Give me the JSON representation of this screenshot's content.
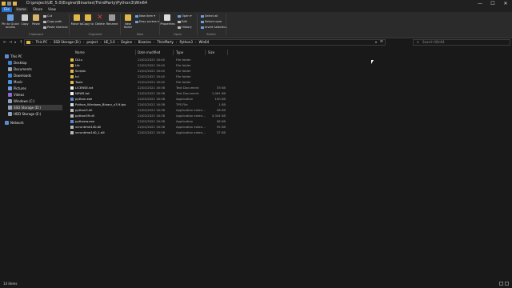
{
  "window": {
    "title": "D:\\project\\UE_5.0\\Engine\\Binaries\\ThirdParty\\Python3\\Win64"
  },
  "window_controls": {
    "minimize": "—",
    "maximize": "☐",
    "close": "✕"
  },
  "tabs": [
    "File",
    "Home",
    "Share",
    "View"
  ],
  "ribbon": {
    "pin": "Pin to Quick access",
    "copy": "Copy",
    "paste": "Paste",
    "cut": "Cut",
    "copy_path": "Copy path",
    "paste_shortcut": "Paste shortcut",
    "move_to": "Move to",
    "copy_to": "Copy to",
    "delete": "Delete",
    "rename": "Rename",
    "new_folder": "New folder",
    "new_item": "New item",
    "easy_access": "Easy access",
    "properties": "Properties",
    "open": "Open",
    "edit": "Edit",
    "history": "History",
    "select_all": "Select all",
    "select_none": "Select none",
    "invert_selection": "Invert selection",
    "groups": {
      "clipboard": "Clipboard",
      "organize": "Organize",
      "new": "New",
      "open": "Open",
      "select": "Select"
    }
  },
  "address": {
    "crumbs": [
      "This PC",
      "SSD Storage (D:)",
      "project",
      "UE_5.0",
      "Engine",
      "Binaries",
      "ThirdParty",
      "Python3",
      "Win64"
    ],
    "search_placeholder": "Search Win64"
  },
  "sidebar": {
    "items": [
      {
        "label": "This PC",
        "icon": "pc-icon"
      },
      {
        "label": "Desktop",
        "icon": "desktop-icon"
      },
      {
        "label": "Documents",
        "icon": "documents-icon"
      },
      {
        "label": "Downloads",
        "icon": "downloads-icon"
      },
      {
        "label": "Music",
        "icon": "music-icon"
      },
      {
        "label": "Pictures",
        "icon": "pictures-icon"
      },
      {
        "label": "Videos",
        "icon": "videos-icon"
      },
      {
        "label": "Windows (C:)",
        "icon": "drive-icon"
      },
      {
        "label": "SSD Storage (D:)",
        "icon": "drive-icon",
        "selected": true
      },
      {
        "label": "HDD Storage (E:)",
        "icon": "drive-icon"
      },
      {
        "label": "Network",
        "icon": "network-icon"
      }
    ]
  },
  "columns": [
    "Name",
    "Date modified",
    "Type",
    "Size"
  ],
  "files": [
    {
      "name": "DLLs",
      "date": "22/02/2022 16:40",
      "type": "File folder",
      "size": "",
      "icon": "folder"
    },
    {
      "name": "Lib",
      "date": "22/02/2022 16:40",
      "type": "File folder",
      "size": "",
      "icon": "folder"
    },
    {
      "name": "Scripts",
      "date": "22/02/2022 16:40",
      "type": "File folder",
      "size": "",
      "icon": "folder"
    },
    {
      "name": "tcl",
      "date": "22/02/2022 16:40",
      "type": "File folder",
      "size": "",
      "icon": "folder"
    },
    {
      "name": "Tools",
      "date": "22/02/2022 16:40",
      "type": "File folder",
      "size": "",
      "icon": "folder"
    },
    {
      "name": "LICENSE.txt",
      "date": "22/02/2022 16:38",
      "type": "Text Document",
      "size": "33 KB",
      "icon": "doc"
    },
    {
      "name": "NEWS.txt",
      "date": "22/02/2022 16:38",
      "type": "Text Document",
      "size": "1,061 KB",
      "icon": "doc"
    },
    {
      "name": "python.exe",
      "date": "22/02/2022 16:38",
      "type": "Application",
      "size": "100 KB",
      "icon": "app"
    },
    {
      "name": "Python_Windows_Binary_v3.9.tps",
      "date": "22/02/2022 16:38",
      "type": "TPS File",
      "size": "1 KB",
      "icon": "tps"
    },
    {
      "name": "python3.dll",
      "date": "22/02/2022 16:38",
      "type": "Application exten...",
      "size": "58 KB",
      "icon": "dll"
    },
    {
      "name": "python39.dll",
      "date": "22/02/2022 16:38",
      "type": "Application exten...",
      "size": "4,344 KB",
      "icon": "dll"
    },
    {
      "name": "pythonw.exe",
      "date": "22/02/2022 16:38",
      "type": "Application",
      "size": "98 KB",
      "icon": "app"
    },
    {
      "name": "vcruntime140.dll",
      "date": "22/02/2022 16:38",
      "type": "Application exten...",
      "size": "95 KB",
      "icon": "dll"
    },
    {
      "name": "vcruntime140_1.dll",
      "date": "22/02/2022 16:38",
      "type": "Application exten...",
      "size": "37 KB",
      "icon": "dll"
    }
  ],
  "status": {
    "count": "14 items"
  }
}
